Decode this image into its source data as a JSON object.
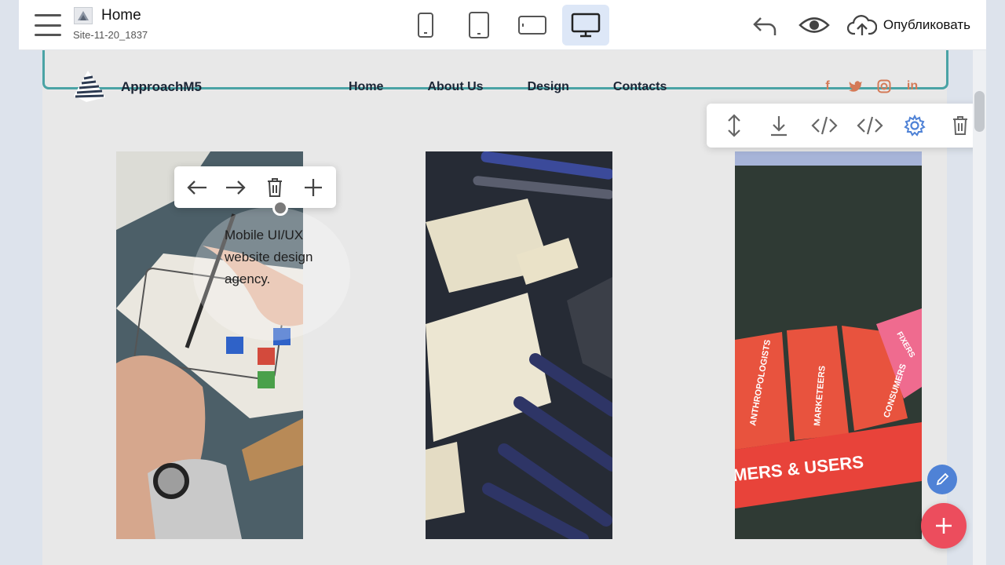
{
  "editor": {
    "page_title": "Home",
    "site_name": "Site-11-20_1837",
    "publish_label": "Опубликовать",
    "devices": [
      "phone-icon",
      "tablet-portrait-icon",
      "tablet-landscape-icon",
      "desktop-icon"
    ],
    "active_device": "desktop-icon"
  },
  "site": {
    "brand": "ApproachM5",
    "nav": [
      "Home",
      "About Us",
      "Design",
      "Contacts"
    ],
    "social": [
      {
        "icon": "facebook-icon",
        "glyph": "f"
      },
      {
        "icon": "twitter-icon",
        "glyph": "t"
      },
      {
        "icon": "instagram-icon",
        "glyph": "◎"
      },
      {
        "icon": "linkedin-icon",
        "glyph": "in"
      }
    ],
    "social_color": "#d47a57",
    "frame_color": "#4aa3a5"
  },
  "block_tools": [
    "move-vertical-icon",
    "download-icon",
    "code-icon",
    "code-icon",
    "settings-icon",
    "trash-icon"
  ],
  "element_tools": [
    "arrow-left-icon",
    "arrow-right-icon",
    "trash-icon",
    "plus-icon"
  ],
  "gallery": {
    "caption": "Mobile UI/UX website design agency.",
    "card3_text": {
      "band": "MERS & USERS",
      "tabs": [
        "ANTHROPOLOGISTS",
        "MARKETEERS",
        "CONSUMERS",
        "FIXERS"
      ]
    }
  },
  "colors": {
    "accent": "#4f82d6",
    "fab_add": "#ec4d5d",
    "active_device_bg": "#dde7f7"
  }
}
